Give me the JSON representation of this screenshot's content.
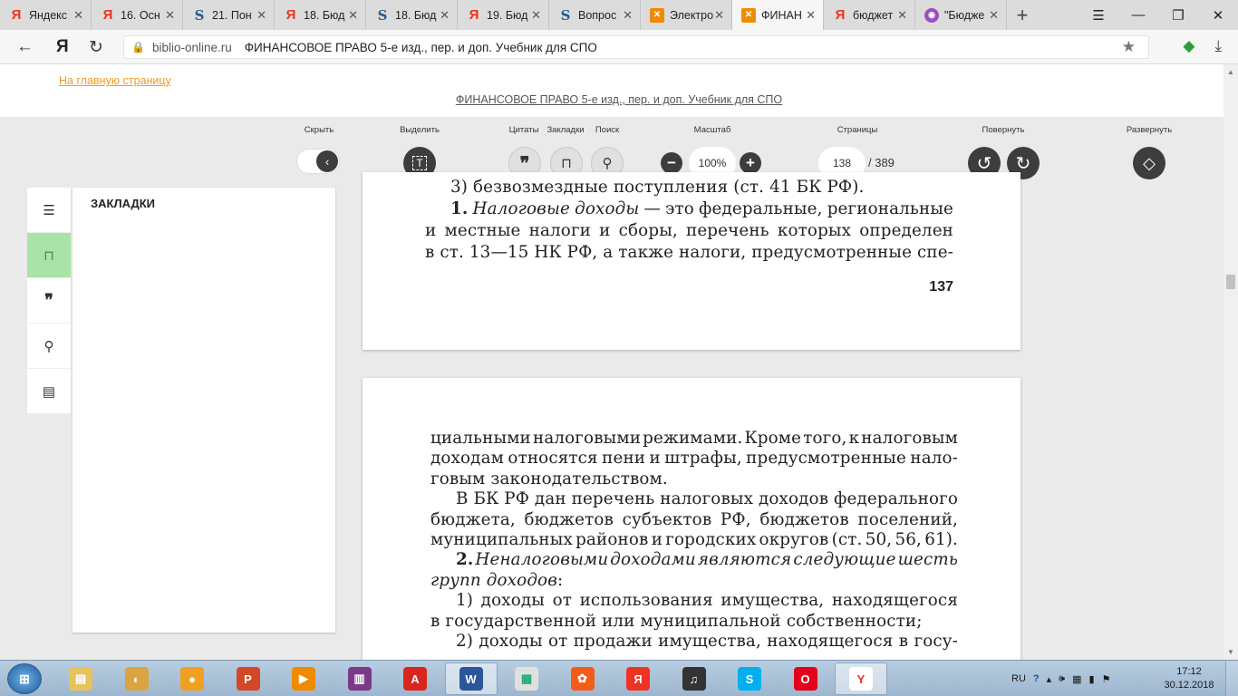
{
  "browser": {
    "tabs": [
      {
        "icon": "yandex-icon",
        "title": "Яндекс",
        "active": false
      },
      {
        "icon": "yandex-icon",
        "title": "16. Осн",
        "active": false
      },
      {
        "icon": "s-icon",
        "title": "21. Пон",
        "active": false
      },
      {
        "icon": "yandex-icon",
        "title": "18. Бюд",
        "active": false
      },
      {
        "icon": "s-icon",
        "title": "18. Бюд",
        "active": false
      },
      {
        "icon": "yandex-icon",
        "title": "19. Бюд",
        "active": false
      },
      {
        "icon": "s-icon",
        "title": "Вопрос",
        "active": false
      },
      {
        "icon": "biblio-icon",
        "title": "Электро",
        "active": false
      },
      {
        "icon": "biblio-icon",
        "title": "ФИНАН",
        "active": true
      },
      {
        "icon": "yandex-icon",
        "title": "бюджет",
        "active": false
      },
      {
        "icon": "globe-icon",
        "title": "\"Бюдже",
        "active": false
      }
    ],
    "address": {
      "domain": "biblio-online.ru",
      "title": "ФИНАНСОВОЕ ПРАВО 5-е изд., пер. и доп. Учебник для СПО"
    }
  },
  "site": {
    "home_link": "На главную страницу",
    "book_title": "ФИНАНСОВОЕ ПРАВО 5-е изд., пер. и доп. Учебник для СПО"
  },
  "toolbar": {
    "hide_label": "Скрыть",
    "select_label": "Выделить",
    "quotes_label": "Цитаты",
    "bookmarks_label": "Закладки",
    "search_label": "Поиск",
    "zoom_label": "Масштаб",
    "zoom_value": "100%",
    "pages_label": "Страницы",
    "current_page": "138",
    "total_pages": "/ 389",
    "rotate_label": "Повернуть",
    "expand_label": "Развернуть"
  },
  "panel": {
    "heading": "ЗАКЛАДКИ"
  },
  "page1": {
    "lines": [
      {
        "html": "3) безвозмездные поступления (ст. 41 БК РФ)."
      },
      {
        "html": "<b>1.</b> <i>Налоговые доходы</i> — это федеральные, региональные"
      },
      {
        "html": "и местные налоги и сборы, перечень которых определен"
      },
      {
        "html": "в ст. 13—15 НК РФ, а также налоги, предусмотренные спе-"
      }
    ],
    "page_number": "137"
  },
  "page2": {
    "lines": [
      {
        "html": "циальными налоговыми режимами. Кроме того, к налоговым"
      },
      {
        "html": "доходам относятся пени и штрафы, предусмотренные нало-"
      },
      {
        "html": "говым законодательством."
      },
      {
        "html": "В БК РФ дан перечень налоговых доходов федерального"
      },
      {
        "html": "бюджета, бюджетов субъектов РФ, бюджетов поселений,"
      },
      {
        "html": "муниципальных районов и городских округов (ст. 50, 56, 61)."
      },
      {
        "html": "<b>2.</b> <i>Неналоговыми доходами являются следующие шесть</i>"
      },
      {
        "html": "<i>групп доходов</i>:"
      },
      {
        "html": "1) доходы от использования имущества, находящегося"
      },
      {
        "html": "в государственной или муниципальной собственности;"
      },
      {
        "html": "2) доходы от продажи имущества, находящегося в госу-"
      }
    ]
  },
  "taskbar": {
    "apps": [
      "explorer",
      "app2",
      "app3",
      "powerpoint",
      "media",
      "winrar",
      "acrobat",
      "word",
      "apps",
      "app4",
      "yandex",
      "audio",
      "skype",
      "opera",
      "yandex-browser"
    ],
    "lang": "RU",
    "time": "17:12",
    "date": "30.12.2018"
  }
}
